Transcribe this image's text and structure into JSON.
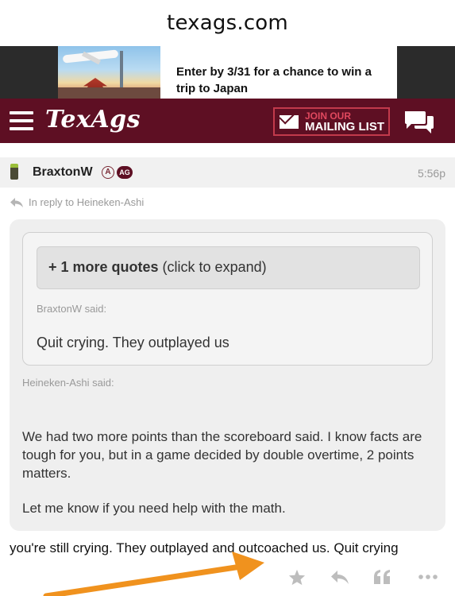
{
  "browser": {
    "url": "texags.com"
  },
  "ad": {
    "line1": "Enter by 3/31 for a chance to win a",
    "line2": "trip to Japan"
  },
  "header": {
    "logo": "TexAgs",
    "mailing_line1": "JOIN OUR",
    "mailing_line2": "MAILING LIST",
    "brand_color": "#5e0f23"
  },
  "post": {
    "username": "BraxtonW",
    "badge_a": "A",
    "badge_ag": "AG",
    "time": "5:56p",
    "reply_to": "In reply to Heineken-Ashi",
    "expand_bold": "+ 1 more quotes",
    "expand_rest": " (click to expand)",
    "inner_said": "BraxtonW said:",
    "inner_quote": "Quit crying. They outplayed us",
    "outer_said": "Heineken-Ashi said:",
    "outer_quote_p1": "We had two more points than the scoreboard said. I know facts are tough for you, but in a game decided by double overtime, 2 points matters.",
    "outer_quote_p2": "Let me know if you need help with the math.",
    "body": "you're still crying. They outplayed and outcoached us. Quit crying"
  },
  "icons": [
    "hamburger-icon",
    "mail-icon",
    "chat-icon",
    "phone-icon",
    "reply-arrow-icon",
    "star-icon",
    "reply-icon",
    "quote-icon",
    "more-icon"
  ],
  "annotation_color": "#f0921e"
}
